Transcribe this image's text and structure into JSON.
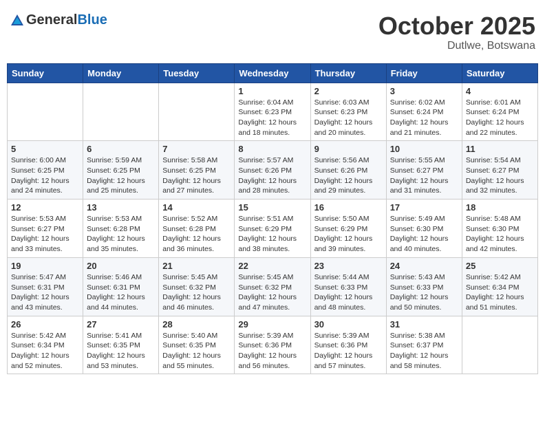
{
  "header": {
    "logo_general": "General",
    "logo_blue": "Blue",
    "month": "October 2025",
    "location": "Dutlwe, Botswana"
  },
  "weekdays": [
    "Sunday",
    "Monday",
    "Tuesday",
    "Wednesday",
    "Thursday",
    "Friday",
    "Saturday"
  ],
  "weeks": [
    [
      {
        "day": "",
        "info": ""
      },
      {
        "day": "",
        "info": ""
      },
      {
        "day": "",
        "info": ""
      },
      {
        "day": "1",
        "info": "Sunrise: 6:04 AM\nSunset: 6:23 PM\nDaylight: 12 hours\nand 18 minutes."
      },
      {
        "day": "2",
        "info": "Sunrise: 6:03 AM\nSunset: 6:23 PM\nDaylight: 12 hours\nand 20 minutes."
      },
      {
        "day": "3",
        "info": "Sunrise: 6:02 AM\nSunset: 6:24 PM\nDaylight: 12 hours\nand 21 minutes."
      },
      {
        "day": "4",
        "info": "Sunrise: 6:01 AM\nSunset: 6:24 PM\nDaylight: 12 hours\nand 22 minutes."
      }
    ],
    [
      {
        "day": "5",
        "info": "Sunrise: 6:00 AM\nSunset: 6:25 PM\nDaylight: 12 hours\nand 24 minutes."
      },
      {
        "day": "6",
        "info": "Sunrise: 5:59 AM\nSunset: 6:25 PM\nDaylight: 12 hours\nand 25 minutes."
      },
      {
        "day": "7",
        "info": "Sunrise: 5:58 AM\nSunset: 6:25 PM\nDaylight: 12 hours\nand 27 minutes."
      },
      {
        "day": "8",
        "info": "Sunrise: 5:57 AM\nSunset: 6:26 PM\nDaylight: 12 hours\nand 28 minutes."
      },
      {
        "day": "9",
        "info": "Sunrise: 5:56 AM\nSunset: 6:26 PM\nDaylight: 12 hours\nand 29 minutes."
      },
      {
        "day": "10",
        "info": "Sunrise: 5:55 AM\nSunset: 6:27 PM\nDaylight: 12 hours\nand 31 minutes."
      },
      {
        "day": "11",
        "info": "Sunrise: 5:54 AM\nSunset: 6:27 PM\nDaylight: 12 hours\nand 32 minutes."
      }
    ],
    [
      {
        "day": "12",
        "info": "Sunrise: 5:53 AM\nSunset: 6:27 PM\nDaylight: 12 hours\nand 33 minutes."
      },
      {
        "day": "13",
        "info": "Sunrise: 5:53 AM\nSunset: 6:28 PM\nDaylight: 12 hours\nand 35 minutes."
      },
      {
        "day": "14",
        "info": "Sunrise: 5:52 AM\nSunset: 6:28 PM\nDaylight: 12 hours\nand 36 minutes."
      },
      {
        "day": "15",
        "info": "Sunrise: 5:51 AM\nSunset: 6:29 PM\nDaylight: 12 hours\nand 38 minutes."
      },
      {
        "day": "16",
        "info": "Sunrise: 5:50 AM\nSunset: 6:29 PM\nDaylight: 12 hours\nand 39 minutes."
      },
      {
        "day": "17",
        "info": "Sunrise: 5:49 AM\nSunset: 6:30 PM\nDaylight: 12 hours\nand 40 minutes."
      },
      {
        "day": "18",
        "info": "Sunrise: 5:48 AM\nSunset: 6:30 PM\nDaylight: 12 hours\nand 42 minutes."
      }
    ],
    [
      {
        "day": "19",
        "info": "Sunrise: 5:47 AM\nSunset: 6:31 PM\nDaylight: 12 hours\nand 43 minutes."
      },
      {
        "day": "20",
        "info": "Sunrise: 5:46 AM\nSunset: 6:31 PM\nDaylight: 12 hours\nand 44 minutes."
      },
      {
        "day": "21",
        "info": "Sunrise: 5:45 AM\nSunset: 6:32 PM\nDaylight: 12 hours\nand 46 minutes."
      },
      {
        "day": "22",
        "info": "Sunrise: 5:45 AM\nSunset: 6:32 PM\nDaylight: 12 hours\nand 47 minutes."
      },
      {
        "day": "23",
        "info": "Sunrise: 5:44 AM\nSunset: 6:33 PM\nDaylight: 12 hours\nand 48 minutes."
      },
      {
        "day": "24",
        "info": "Sunrise: 5:43 AM\nSunset: 6:33 PM\nDaylight: 12 hours\nand 50 minutes."
      },
      {
        "day": "25",
        "info": "Sunrise: 5:42 AM\nSunset: 6:34 PM\nDaylight: 12 hours\nand 51 minutes."
      }
    ],
    [
      {
        "day": "26",
        "info": "Sunrise: 5:42 AM\nSunset: 6:34 PM\nDaylight: 12 hours\nand 52 minutes."
      },
      {
        "day": "27",
        "info": "Sunrise: 5:41 AM\nSunset: 6:35 PM\nDaylight: 12 hours\nand 53 minutes."
      },
      {
        "day": "28",
        "info": "Sunrise: 5:40 AM\nSunset: 6:35 PM\nDaylight: 12 hours\nand 55 minutes."
      },
      {
        "day": "29",
        "info": "Sunrise: 5:39 AM\nSunset: 6:36 PM\nDaylight: 12 hours\nand 56 minutes."
      },
      {
        "day": "30",
        "info": "Sunrise: 5:39 AM\nSunset: 6:36 PM\nDaylight: 12 hours\nand 57 minutes."
      },
      {
        "day": "31",
        "info": "Sunrise: 5:38 AM\nSunset: 6:37 PM\nDaylight: 12 hours\nand 58 minutes."
      },
      {
        "day": "",
        "info": ""
      }
    ]
  ]
}
